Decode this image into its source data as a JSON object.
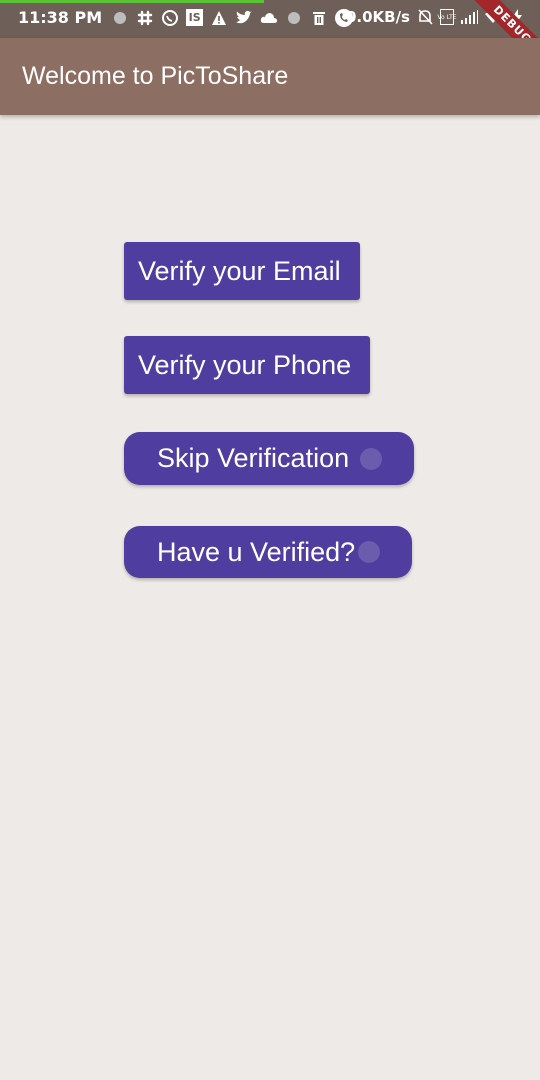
{
  "status_bar": {
    "time": "11:38 PM",
    "net_speed": "0.0KB/s",
    "icons": [
      "dot-icon",
      "slack-icon",
      "whatsapp-icon",
      "is-icon",
      "warning-icon",
      "twitter-icon",
      "cloud-icon",
      "dot-icon",
      "delete-icon",
      "phone-icon",
      "bell-off-icon",
      "volte-icon",
      "signal-icon",
      "wifi-icon",
      "charging-icon"
    ],
    "is_icon_text": "IS",
    "volte_text": "Vo LTE",
    "progress_color": "#5BC236"
  },
  "debug_banner": "DEBUG",
  "app_bar": {
    "title": "Welcome to PicToShare",
    "color": "#8D6E63"
  },
  "buttons": {
    "verify_email": "Verify your Email",
    "verify_phone": "Verify your Phone",
    "skip_verification": "Skip Verification",
    "have_verified": "Have u Verified?"
  },
  "colors": {
    "button": "#4F3D9F",
    "background": "#EEEAE7"
  }
}
